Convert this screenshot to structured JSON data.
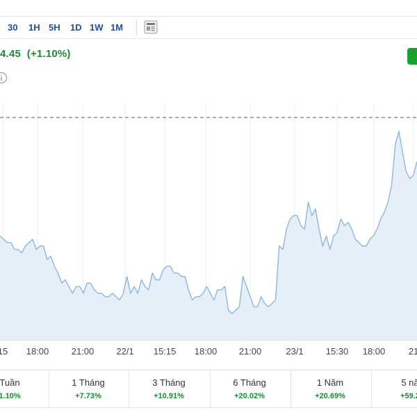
{
  "toolbar": {
    "timeframes": [
      "30",
      "1H",
      "5H",
      "1D",
      "1W",
      "1M"
    ]
  },
  "quote": {
    "change_abs": "4.45",
    "change_pct": "(+1.10%)",
    "up_color": "#1a8a34"
  },
  "icons": {
    "calendar_news": "newspaper-icon",
    "info": "info-icon"
  },
  "chart_data": {
    "type": "area",
    "x_tick_labels": [
      "15",
      "18:00",
      "21:00",
      "22/1",
      "15:15",
      "18:00",
      "21:00",
      "23/1",
      "15:30",
      "18:00",
      "21"
    ],
    "values": [
      2.1,
      2.0,
      1.9,
      1.9,
      1.7,
      1.7,
      1.6,
      1.8,
      1.9,
      2.0,
      1.7,
      1.8,
      1.8,
      1.4,
      1.5,
      1.2,
      1.0,
      0.7,
      0.8,
      0.6,
      0.4,
      0.6,
      0.6,
      0.4,
      0.7,
      0.7,
      0.5,
      0.4,
      0.4,
      0.3,
      0.3,
      0.4,
      0.3,
      0.2,
      0.4,
      0.9,
      0.4,
      0.6,
      0.4,
      0.8,
      0.6,
      0.5,
      1.0,
      0.8,
      0.8,
      1.1,
      1.2,
      1.2,
      1.0,
      1.0,
      0.9,
      0.9,
      0.5,
      0.2,
      0.3,
      0.3,
      0.4,
      0.6,
      0.4,
      0.2,
      0.5,
      0.5,
      0.6,
      -0.1,
      -0.2,
      -0.1,
      0.0,
      0.9,
      0.6,
      0.3,
      0.0,
      0.0,
      0.3,
      0.1,
      0.0,
      0.1,
      0.2,
      1.8,
      1.7,
      2.3,
      2.6,
      2.7,
      2.7,
      2.4,
      2.3,
      3.1,
      2.7,
      2.9,
      2.3,
      1.8,
      2.1,
      1.7,
      2.1,
      2.2,
      2.6,
      2.4,
      2.5,
      2.3,
      2.0,
      1.9,
      1.8,
      1.8,
      2.0,
      2.1,
      2.3,
      2.6,
      2.8,
      3.1,
      3.6,
      4.8,
      5.2,
      4.6,
      4.0,
      3.8,
      3.9,
      4.3
    ],
    "reference_line": "dashed",
    "line_color": "#8cb6dd",
    "fill_color": "#e6eff8",
    "grid": "vertical"
  },
  "performance": [
    {
      "label": "Tuần",
      "value": "1.10%"
    },
    {
      "label": "1 Tháng",
      "value": "+7.73%"
    },
    {
      "label": "3 Tháng",
      "value": "+10.91%"
    },
    {
      "label": "6 Tháng",
      "value": "+20.02%"
    },
    {
      "label": "1 Năm",
      "value": "+20.69%"
    },
    {
      "label": "5 nă",
      "value": "+59.2"
    }
  ]
}
